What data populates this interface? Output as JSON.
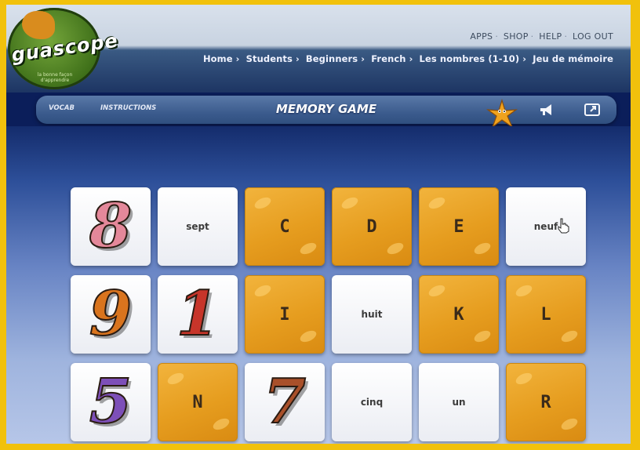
{
  "logo": {
    "text": "guascope",
    "tagline": "la bonne façon d'apprendre"
  },
  "top_links": [
    "APPS",
    "SHOP",
    "HELP",
    "LOG OUT"
  ],
  "breadcrumb": [
    "Home",
    "Students",
    "Beginners",
    "French",
    "Les nombres (1-10)",
    "Jeu de mémoire"
  ],
  "gamebar": {
    "tabs": [
      "VOCAB",
      "INSTRUCTIONS"
    ],
    "title": "MEMORY GAME"
  },
  "icons": {
    "mascot": "starfish-mascot-icon",
    "megaphone": "megaphone-icon",
    "fullscreen": "fullscreen-icon"
  },
  "colors": {
    "card_back": "#e69d1f",
    "card_face": "#ffffff",
    "digit_8": "#e4889a",
    "digit_9": "#d9741e",
    "digit_1": "#c7352a",
    "digit_5": "#7d4fb8",
    "digit_7": "#a9502a"
  },
  "cards": [
    {
      "type": "digit",
      "value": "8",
      "color": "#e4889a"
    },
    {
      "type": "word",
      "value": "sept"
    },
    {
      "type": "back",
      "value": "C"
    },
    {
      "type": "back",
      "value": "D"
    },
    {
      "type": "back",
      "value": "E"
    },
    {
      "type": "word",
      "value": "neuf"
    },
    {
      "type": "digit",
      "value": "9",
      "color": "#d9741e"
    },
    {
      "type": "digit",
      "value": "1",
      "color": "#c7352a"
    },
    {
      "type": "back",
      "value": "I"
    },
    {
      "type": "word",
      "value": "huit"
    },
    {
      "type": "back",
      "value": "K"
    },
    {
      "type": "back",
      "value": "L"
    },
    {
      "type": "digit",
      "value": "5",
      "color": "#7d4fb8"
    },
    {
      "type": "back",
      "value": "N"
    },
    {
      "type": "digit",
      "value": "7",
      "color": "#a9502a"
    },
    {
      "type": "word",
      "value": "cinq"
    },
    {
      "type": "word",
      "value": "un"
    },
    {
      "type": "back",
      "value": "R"
    }
  ]
}
